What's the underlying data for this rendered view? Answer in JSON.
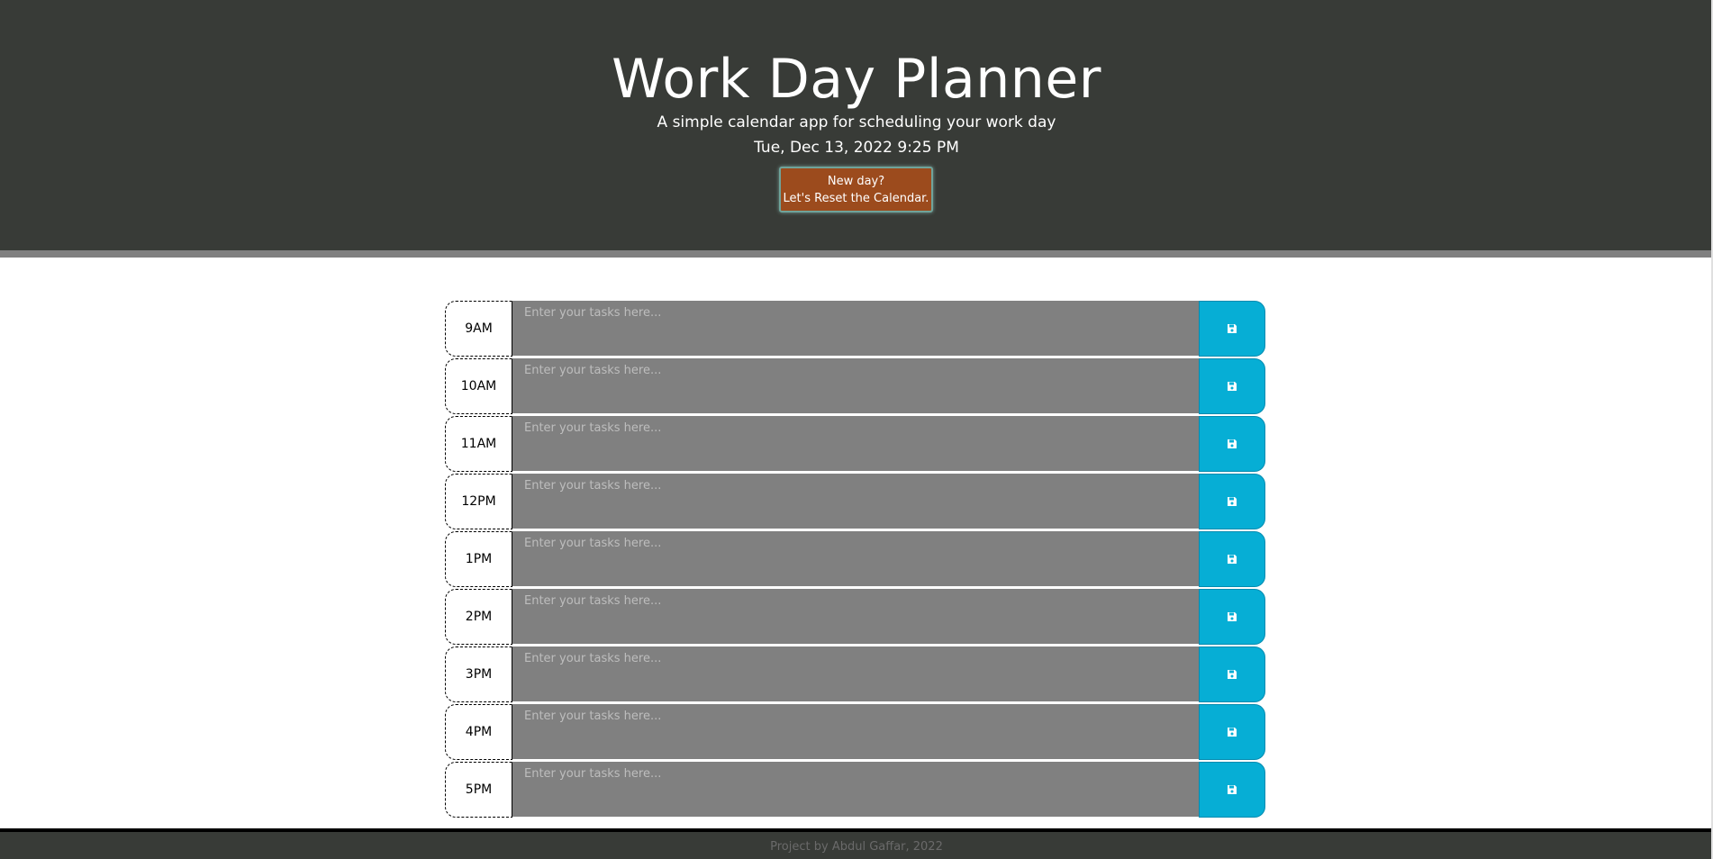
{
  "header": {
    "title": "Work Day Planner",
    "subtitle": "A simple calendar app for scheduling your work day",
    "datetime": "Tue, Dec 13, 2022 9:25 PM",
    "reset_line1": "New day?",
    "reset_line2": "Let's Reset the Calendar."
  },
  "planner": {
    "placeholder": "Enter your tasks here...",
    "rows": [
      {
        "hour": "9AM",
        "task": ""
      },
      {
        "hour": "10AM",
        "task": ""
      },
      {
        "hour": "11AM",
        "task": ""
      },
      {
        "hour": "12PM",
        "task": ""
      },
      {
        "hour": "1PM",
        "task": ""
      },
      {
        "hour": "2PM",
        "task": ""
      },
      {
        "hour": "3PM",
        "task": ""
      },
      {
        "hour": "4PM",
        "task": ""
      },
      {
        "hour": "5PM",
        "task": ""
      }
    ],
    "save_icon": "floppy-disk-icon"
  },
  "footer": {
    "credit": "Project by Abdul Gaffar, 2022"
  },
  "colors": {
    "header_bg": "#383b37",
    "header_border": "#808080",
    "reset_button_bg": "#9c4b1d",
    "task_bg": "#808080",
    "save_button_bg": "#06aed5"
  }
}
